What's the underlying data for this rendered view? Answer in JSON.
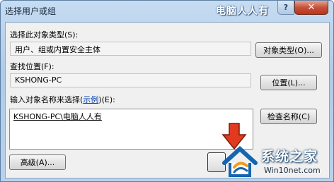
{
  "window": {
    "title": "选择用户或组",
    "watermark_top": "电脑人人有",
    "help_label": "?",
    "close_label": "✕"
  },
  "object_type": {
    "label_text": "选择此对象类型",
    "label_key": "(S):",
    "value": "用户、组或内置安全主体",
    "button": "对象类型(O)..."
  },
  "location": {
    "label_text": "查找位置",
    "label_key": "(F):",
    "value": "KSHONG-PC",
    "button": "位置(L)..."
  },
  "names": {
    "label_text": "输入对象名称来选择",
    "label_link": "示例",
    "label_key": "(E):",
    "value": "KSHONG-PC\\电脑人人有",
    "check_button": "检查名称(C)"
  },
  "advanced_button": "高级(A)...",
  "watermark_logo": {
    "name": "系统之家",
    "url": "Win10net.com"
  },
  "colors": {
    "arrow": "#e23a1f",
    "logo_blue": "#1565b0",
    "logo_orange": "#f39a1c"
  }
}
